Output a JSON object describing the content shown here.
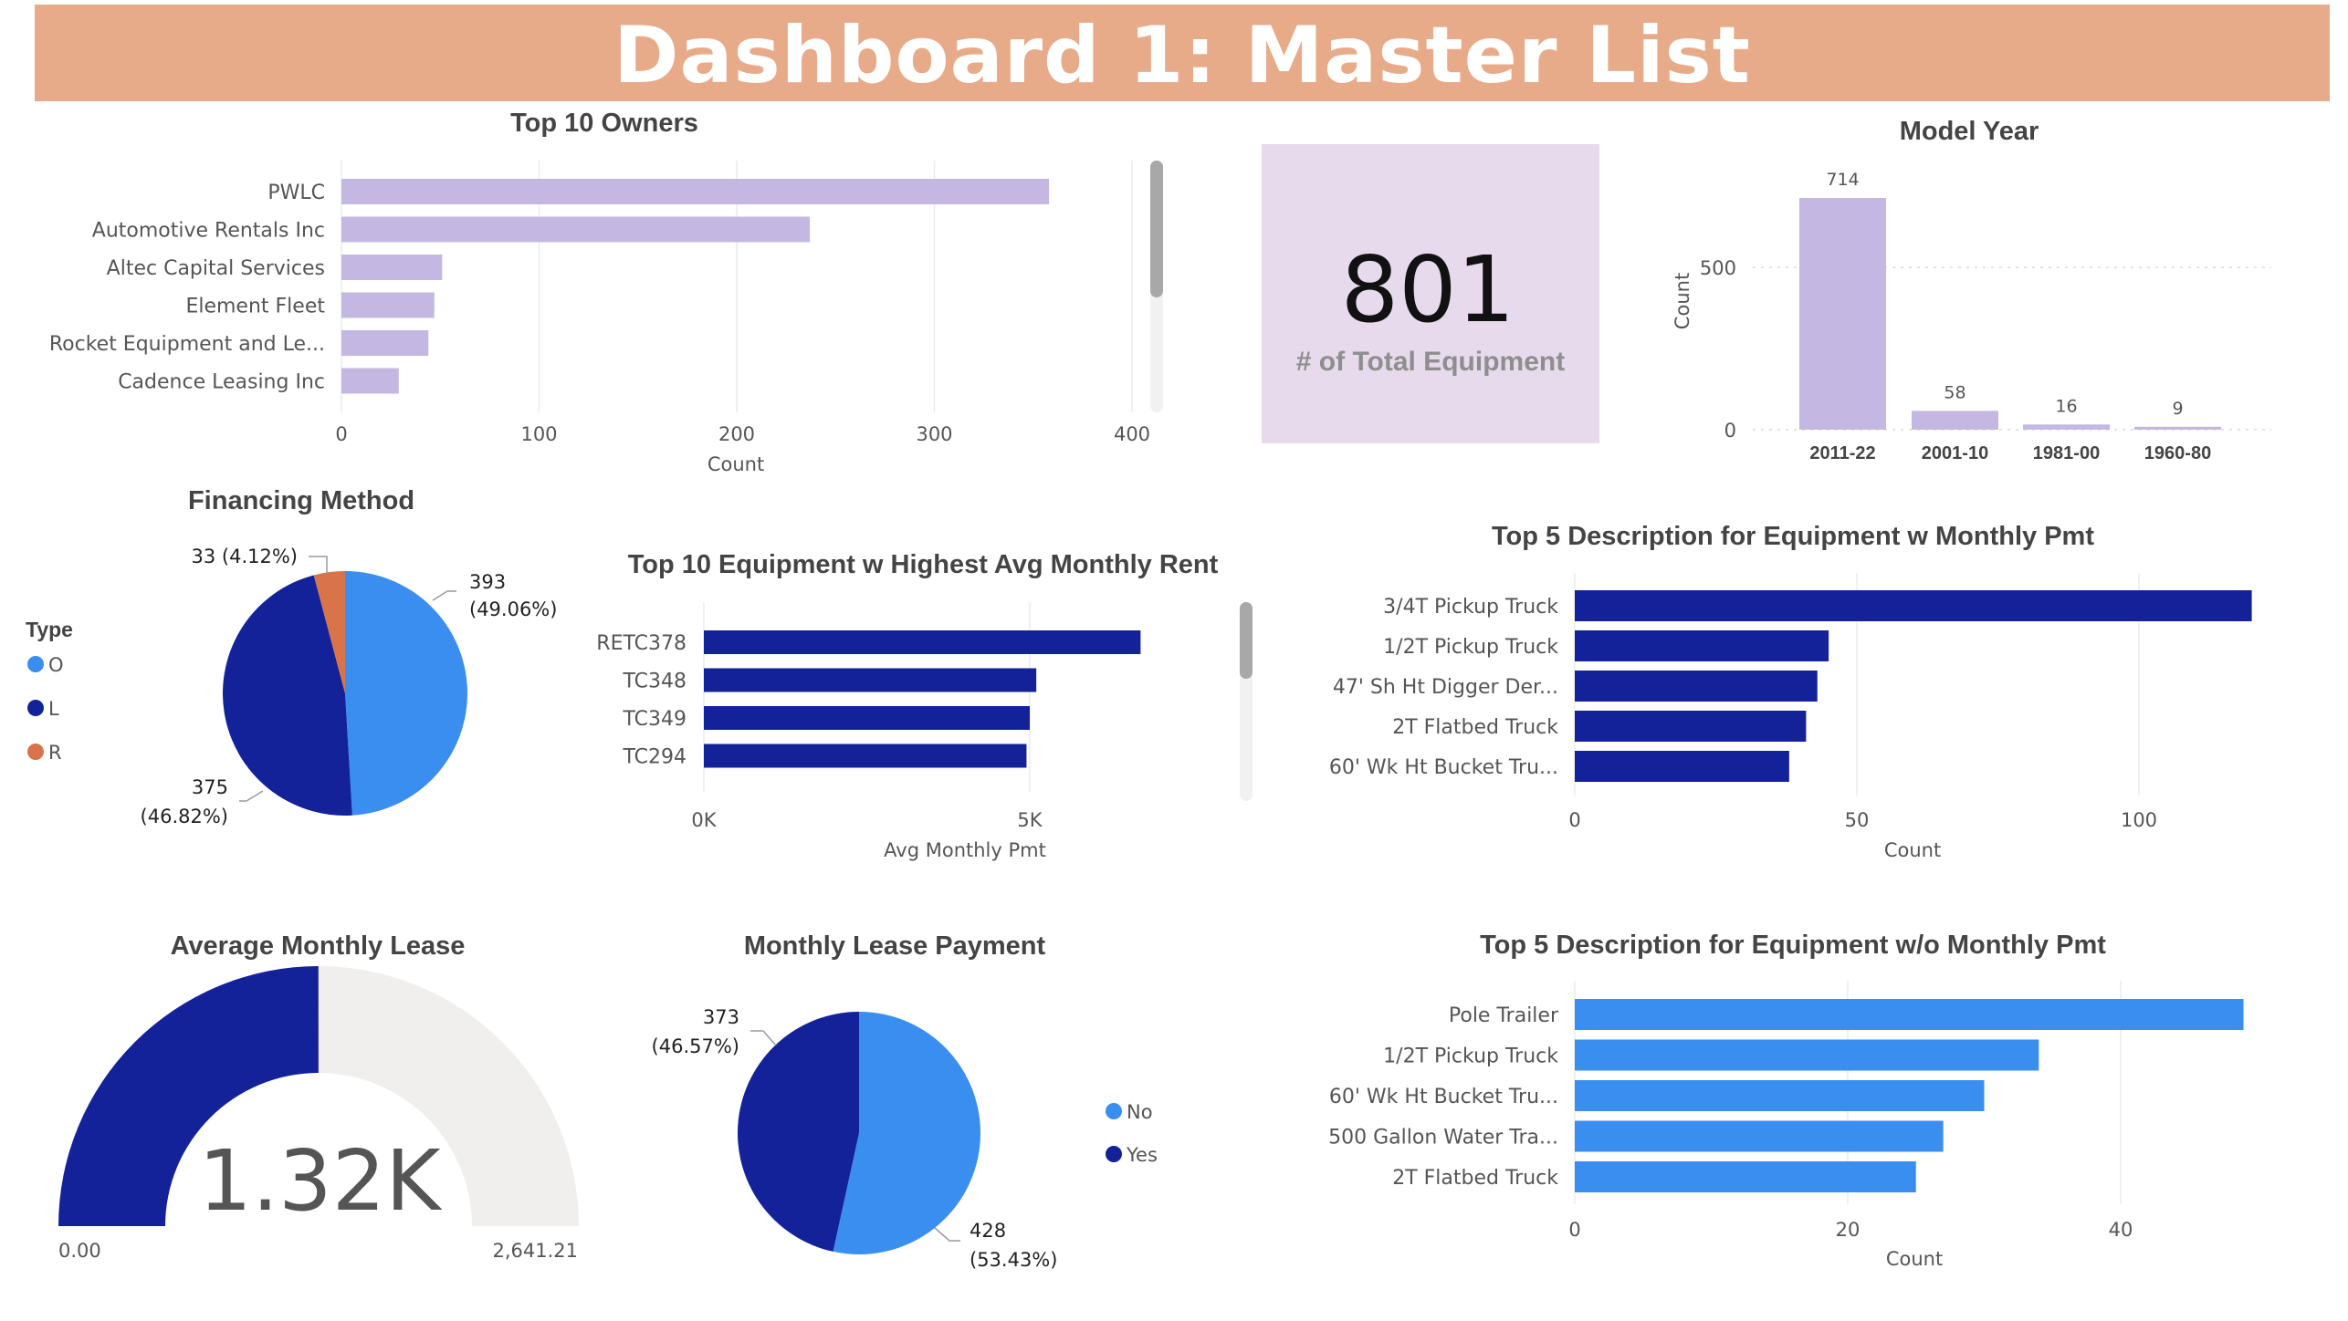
{
  "banner": {
    "title": "Dashboard 1: Master List"
  },
  "colors": {
    "lavender": "#c4b8e2",
    "navy": "#14229a",
    "blue": "#3a8ef0",
    "orange": "#d9734a",
    "banner": "#e8ab8a",
    "card": "#e6daec",
    "gauge_track": "#f0efee"
  },
  "kpi": {
    "value": "801",
    "label": "# of Total Equipment"
  },
  "gauge": {
    "title": "Average Monthly Lease",
    "value": 1320,
    "value_label": "1.32K",
    "min_label": "0.00",
    "max_label": "2,641.21",
    "min": 0,
    "max": 2641.21
  },
  "chart_data": [
    {
      "id": "owners",
      "type": "bar",
      "orientation": "horizontal",
      "title": "Top 10 Owners",
      "xlabel": "Count",
      "categories": [
        "PWLC",
        "Automotive Rentals Inc",
        "Altec Capital Services",
        "Element Fleet",
        "Rocket Equipment and Le...",
        "Cadence Leasing Inc"
      ],
      "values": [
        358,
        237,
        51,
        47,
        44,
        29
      ],
      "xlim": [
        0,
        400
      ],
      "ticks": [
        "0",
        "100",
        "200",
        "300",
        "400"
      ],
      "tick_values": [
        0,
        100,
        200,
        300,
        400
      ],
      "color": "#c4b8e2",
      "grid": true
    },
    {
      "id": "model_year",
      "type": "bar",
      "orientation": "vertical",
      "title": "Model Year",
      "ylabel": "Count",
      "categories": [
        "2011-22",
        "2001-10",
        "1981-00",
        "1960-80"
      ],
      "values": [
        714,
        58,
        16,
        9
      ],
      "data_labels": [
        "714",
        "58",
        "16",
        "9"
      ],
      "ylim": [
        0,
        714
      ],
      "ticks": [
        "0",
        "500"
      ],
      "tick_values": [
        0,
        500
      ],
      "color": "#c4b8e2",
      "grid": true
    },
    {
      "id": "financing",
      "type": "pie",
      "title": "Financing Method",
      "legend_title": "Type",
      "legend_position": "left",
      "legend": [
        "O",
        "L",
        "R"
      ],
      "slices": [
        {
          "name": "O",
          "value": 393,
          "label": "393",
          "pct": "(49.06%)",
          "color": "#3a8ef0"
        },
        {
          "name": "L",
          "value": 375,
          "label": "375",
          "pct": "(46.82%)",
          "color": "#14229a"
        },
        {
          "name": "R",
          "value": 33,
          "label": "33 (4.12%)",
          "pct": "",
          "color": "#d9734a"
        }
      ]
    },
    {
      "id": "rent",
      "type": "bar",
      "orientation": "horizontal",
      "title": "Top 10 Equipment w Highest Avg Monthly Rent",
      "xlabel": "Avg Monthly Pmt",
      "categories": [
        "RETC378",
        "TC348",
        "TC349",
        "TC294"
      ],
      "values": [
        6700,
        5100,
        5000,
        4950
      ],
      "xlim": [
        0,
        5000
      ],
      "ticks": [
        "0K",
        "5K"
      ],
      "tick_values": [
        0,
        5000
      ],
      "color": "#14229a",
      "grid": true
    },
    {
      "id": "desc_pmt",
      "type": "bar",
      "orientation": "horizontal",
      "title": "Top 5 Description for Equipment w Monthly Pmt",
      "xlabel": "Count",
      "categories": [
        "3/4T Pickup Truck",
        "1/2T Pickup Truck",
        "47' Sh Ht Digger Der...",
        "2T Flatbed Truck",
        "60' Wk Ht Bucket Tru..."
      ],
      "values": [
        120,
        45,
        43,
        41,
        38
      ],
      "xlim": [
        0,
        100
      ],
      "ticks": [
        "0",
        "50",
        "100"
      ],
      "tick_values": [
        0,
        50,
        100
      ],
      "color": "#14229a",
      "grid": true
    },
    {
      "id": "lease_pie",
      "type": "pie",
      "title": "Monthly Lease Payment",
      "legend_position": "right",
      "legend": [
        "No",
        "Yes"
      ],
      "slices": [
        {
          "name": "No",
          "value": 428,
          "label": "428",
          "pct": "(53.43%)",
          "color": "#3a8ef0"
        },
        {
          "name": "Yes",
          "value": 373,
          "label": "373",
          "pct": "(46.57%)",
          "color": "#14229a"
        }
      ]
    },
    {
      "id": "desc_nopmt",
      "type": "bar",
      "orientation": "horizontal",
      "title": "Top 5 Description for Equipment w/o Monthly Pmt",
      "xlabel": "Count",
      "categories": [
        "Pole Trailer",
        "1/2T Pickup Truck",
        "60' Wk Ht Bucket Tru...",
        "500 Gallon Water Tra...",
        "2T Flatbed Truck"
      ],
      "values": [
        49,
        34,
        30,
        27,
        25
      ],
      "xlim": [
        0,
        40
      ],
      "ticks": [
        "0",
        "20",
        "40"
      ],
      "tick_values": [
        0,
        20,
        40
      ],
      "color": "#3a8ef0",
      "grid": true
    }
  ]
}
